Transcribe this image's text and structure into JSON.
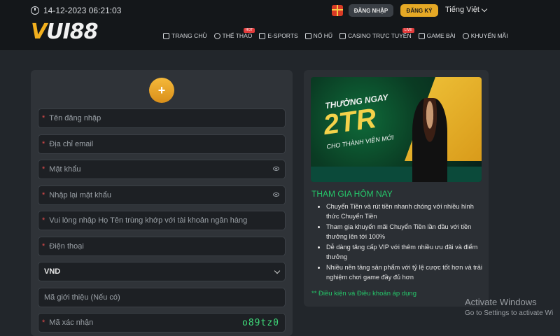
{
  "header": {
    "datetime": "14-12-2023 06:21:03",
    "logo_text_v": "V",
    "logo_text_rest": "UI88",
    "login_label": "ĐĂNG NHẬP",
    "register_label": "ĐĂNG KÝ",
    "language": "Tiếng Việt",
    "accent_color": "#e5a825"
  },
  "nav": [
    {
      "label": "TRANG CHỦ",
      "icon": "home-icon"
    },
    {
      "label": "THỂ THAO",
      "icon": "ball-icon",
      "badge": "HOT"
    },
    {
      "label": "E-SPORTS",
      "icon": "gamepad-icon"
    },
    {
      "label": "NỔ HŨ",
      "icon": "slot-icon"
    },
    {
      "label": "CASINO TRỰC TUYẾN",
      "icon": "cards-icon",
      "badge": "LIVE"
    },
    {
      "label": "GAME BÀI",
      "icon": "card-game-icon"
    },
    {
      "label": "KHUYẾN MÃI",
      "icon": "promo-icon"
    }
  ],
  "form": {
    "username_placeholder": "Tên đăng nhập",
    "email_placeholder": "Địa chỉ email",
    "password_placeholder": "Mật khẩu",
    "confirm_password_placeholder": "Nhập lại mật khẩu",
    "fullname_placeholder": "Vui lòng nhập Họ Tên trùng khớp với tài khoản ngân hàng",
    "phone_placeholder": "Điện thoại",
    "currency_value": "VND",
    "referral_placeholder": "Mã giới thiệu (Nếu có)",
    "captcha_placeholder": "Mã xác nhận",
    "captcha_code": "o89tz0",
    "required_mark": "*"
  },
  "promo": {
    "banner_line1": "THƯỞNG NGAY",
    "banner_line2": "2TR",
    "banner_line3": "CHO THÀNH VIÊN MỚI",
    "title": "THAM GIA HÔM NAY",
    "items": [
      "Chuyển Tiền và rút tiền nhanh chóng với nhiều hình thức Chuyển Tiền",
      "Tham gia khuyến mãi Chuyển Tiền lần đầu với tiền thưởng lên tới 100%",
      "Dễ dàng tăng cấp VIP với thêm nhiều ưu đãi và điểm thưởng",
      "Nhiều nền tảng sản phẩm với tỷ lệ cược tốt hơn và trải nghiệm chơi game đầy đủ hơn"
    ],
    "terms": "** Điều kiện và Điều khoản áp dụng"
  },
  "watermark": {
    "line1": "Activate Windows",
    "line2": "Go to Settings to activate Wi"
  }
}
